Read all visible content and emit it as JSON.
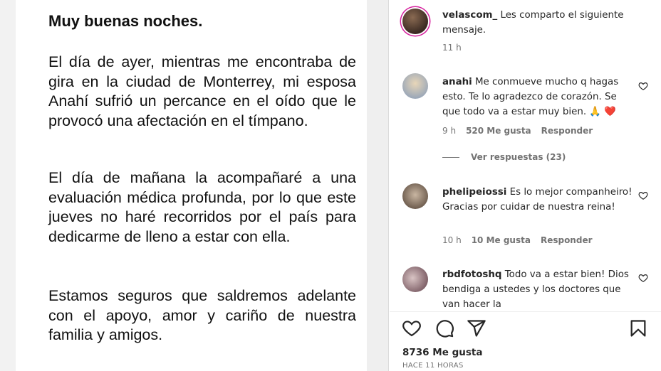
{
  "letter": {
    "greeting": "Muy buenas noches.",
    "paragraphs": [
      "El día de ayer, mientras me encontraba de gira en la ciudad de Monterrey, mi esposa Anahí sufrió un percance en el oído que le provocó una afectación en el tímpano.",
      "El día de mañana la acompañaré a una evaluación médica profunda, por lo que este jueves no haré recorridos por el país para dedicarme de lleno a estar con ella.",
      "Estamos seguros que saldremos adelante con el apoyo, amor y cariño de nuestra familia y amigos."
    ]
  },
  "caption": {
    "username": "velascom_",
    "text": "Les comparto el siguiente mensaje.",
    "time": "11 h"
  },
  "comments": [
    {
      "username": "anahi",
      "text": "Me conmueve mucho q hagas esto. Te lo agradezco de corazón. Se que todo va a estar muy bien. 🙏 ❤️",
      "time": "9 h",
      "likes": "520 Me gusta",
      "reply": "Responder",
      "view_replies": "Ver respuestas (23)"
    },
    {
      "username": "phelipeiossi",
      "text": "Es lo mejor companheiro! Gracias por cuidar de nuestra reina!",
      "time": "10 h",
      "likes": "10 Me gusta",
      "reply": "Responder"
    },
    {
      "username": "rbdfotoshq",
      "text": "Todo va a estar bien! Dios bendiga a ustedes y los doctores que van hacer la",
      "time": "",
      "likes": "",
      "reply": ""
    }
  ],
  "actions": {
    "icons": [
      "heart-icon",
      "comment-icon",
      "share-icon",
      "bookmark-icon"
    ],
    "likes": "8736 Me gusta",
    "timestamp": "HACE 11 HORAS"
  },
  "colors": {
    "text": "#262626",
    "muted": "#737373",
    "heart_red": "#ed4956",
    "story_ring": "#d6249f"
  }
}
